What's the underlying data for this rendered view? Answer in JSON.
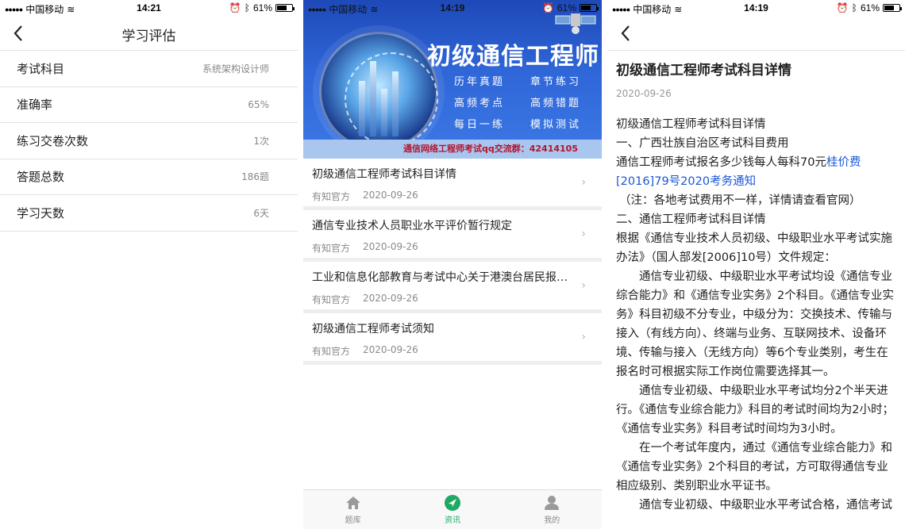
{
  "status": {
    "carrier": "中国移动",
    "battery": "61%",
    "time1": "14:21",
    "time2": "14:19",
    "time3": "14:19"
  },
  "screen1": {
    "title": "学习评估",
    "rows": [
      {
        "label": "考试科目",
        "value": "系统架构设计师"
      },
      {
        "label": "准确率",
        "value": "65%"
      },
      {
        "label": "练习交卷次数",
        "value": "1次"
      },
      {
        "label": "答题总数",
        "value": "186题"
      },
      {
        "label": "学习天数",
        "value": "6天"
      }
    ]
  },
  "screen2": {
    "banner": {
      "title": "初级通信工程师",
      "tags": [
        "历年真题",
        "章节练习",
        "高频考点",
        "高频错题",
        "每日一练",
        "模拟测试"
      ],
      "qq": "通信网络工程师考试qq交流群：42414105"
    },
    "news": [
      {
        "title": "初级通信工程师考试科目详情",
        "source": "有知官方",
        "date": "2020-09-26"
      },
      {
        "title": "通信专业技术人员职业水平评价暂行规定",
        "source": "有知官方",
        "date": "2020-09-26"
      },
      {
        "title": "工业和信息化部教育与考试中心关于港澳台居民报名参加通信专业技术人员职业水平考试",
        "source": "有知官方",
        "date": "2020-09-26"
      },
      {
        "title": "初级通信工程师考试须知",
        "source": "有知官方",
        "date": "2020-09-26"
      }
    ],
    "tabs": [
      {
        "label": "题库",
        "icon": "home-icon"
      },
      {
        "label": "资讯",
        "icon": "compass-icon"
      },
      {
        "label": "我的",
        "icon": "person-icon"
      }
    ],
    "active_tab_color": "#1eaa63"
  },
  "screen3": {
    "title": "初级通信工程师考试科目详情",
    "date": "2020-09-26",
    "heading": "初级通信工程师考试科目详情",
    "sec1": "一、广西壮族自治区考试科目费用",
    "fee_text": "通信工程师考试报名多少钱每人每科70元",
    "fee_link": "桂价费[2016]79号2020考务通知",
    "note": "（注：各地考试费用不一样，详情请查看官网）",
    "sec2": "二、通信工程师考试科目详情",
    "para1": "根据《通信专业技术人员初级、中级职业水平考试实施办法》（国人部发[2006]10号）文件规定：",
    "para2": "通信专业初级、中级职业水平考试均设《通信专业综合能力》和《通信专业实务》2个科目。《通信专业实务》科目初级不分专业，中级分为：交换技术、传输与接入（有线方向）、终端与业务、互联网技术、设备环境、传输与接入（无线方向）等6个专业类别，考生在报名时可根据实际工作岗位需要选择其一。",
    "para3": "通信专业初级、中级职业水平考试均分2个半天进行。《通信专业综合能力》科目的考试时间均为2小时；《通信专业实务》科目考试时间均为3小时。",
    "para4": "在一个考试年度内，通过《通信专业综合能力》和《通信专业实务》2个科目的考试，方可取得通信专业相应级别、类别职业水平证书。",
    "para5": "通信专业初级、中级职业水平考试合格，通信考试"
  }
}
